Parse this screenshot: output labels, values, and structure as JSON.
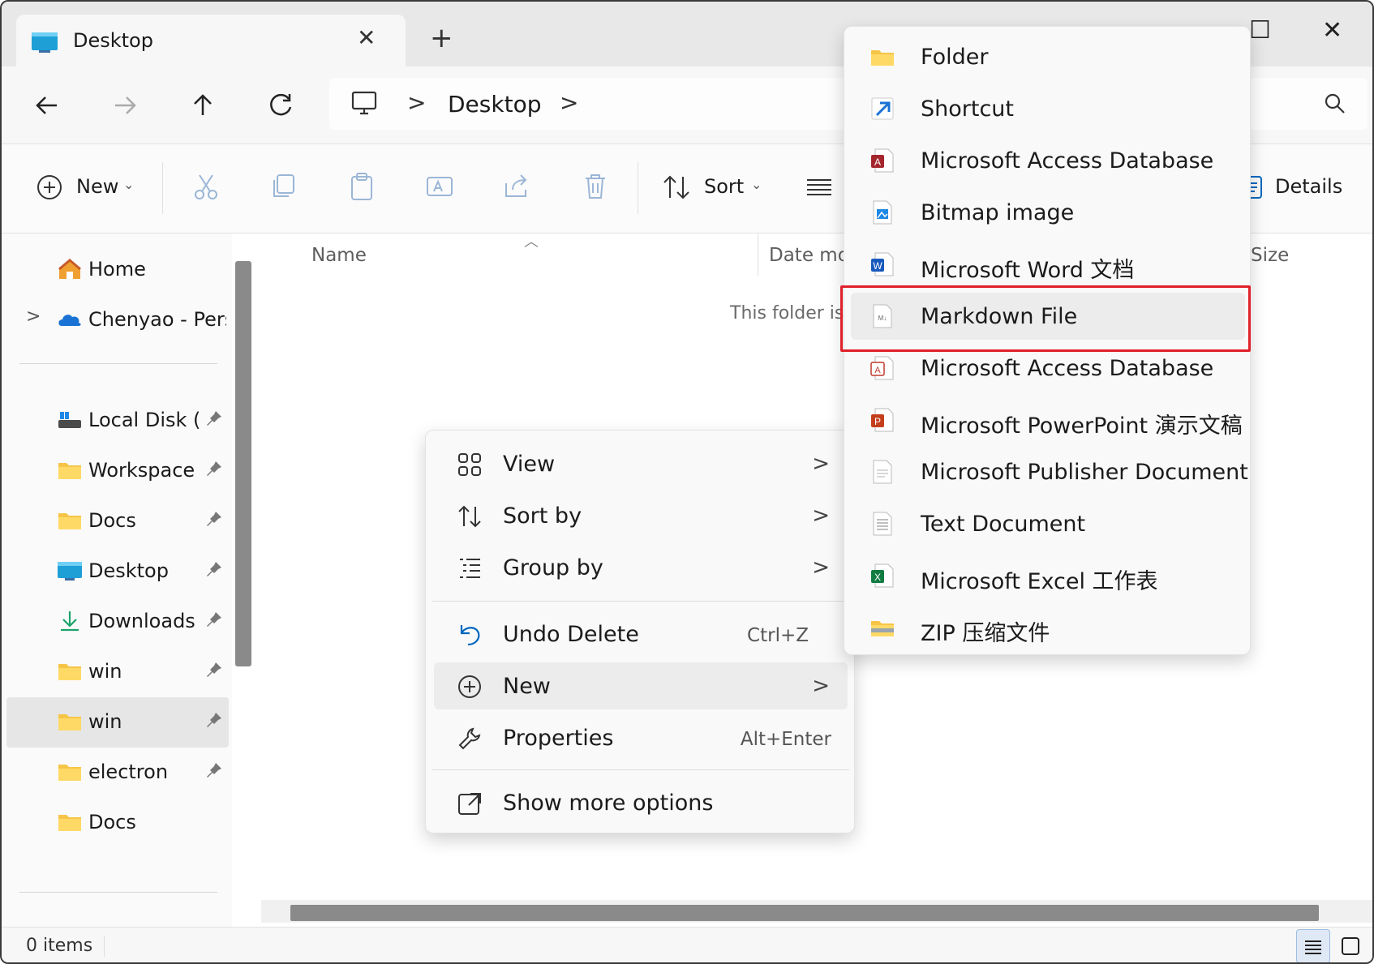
{
  "tab": {
    "title": "Desktop",
    "close_glyph": "✕",
    "new_tab_glyph": "+"
  },
  "window_controls": {
    "minimize": "—",
    "maximize": "☐",
    "close": "✕"
  },
  "nav": {
    "back_icon": "arrow-left-icon",
    "forward_icon": "arrow-right-icon",
    "up_icon": "arrow-up-icon",
    "refresh_icon": "refresh-icon"
  },
  "address": {
    "root_icon": "computer-icon",
    "location": "Desktop",
    "separator": ">"
  },
  "toolbar": {
    "new_label": "New",
    "sort_label": "Sort",
    "details_label": "Details"
  },
  "sidebar": {
    "items": [
      {
        "label": "Home",
        "icon": "home-icon"
      },
      {
        "label": "Chenyao - Perso",
        "icon": "onedrive-icon",
        "expand": ">"
      },
      {
        "label": "Local Disk (C:",
        "icon": "drive-icon"
      },
      {
        "label": "Workspace",
        "icon": "folder-icon"
      },
      {
        "label": "Docs",
        "icon": "folder-icon"
      },
      {
        "label": "Desktop",
        "icon": "desktop-icon"
      },
      {
        "label": "Downloads",
        "icon": "download-icon"
      },
      {
        "label": "win",
        "icon": "folder-icon"
      },
      {
        "label": "win",
        "icon": "folder-icon",
        "selected": true
      },
      {
        "label": "electron",
        "icon": "folder-icon"
      },
      {
        "label": "Docs",
        "icon": "folder-icon"
      }
    ]
  },
  "columns": {
    "name": "Name",
    "date": "Date mo",
    "size": "Size"
  },
  "empty_message": "This folder is",
  "status": {
    "items": "0 items"
  },
  "context_menu": {
    "items": [
      {
        "label": "View",
        "icon": "grid-icon",
        "submenu": ">"
      },
      {
        "label": "Sort by",
        "icon": "sort-icon",
        "submenu": ">"
      },
      {
        "label": "Group by",
        "icon": "group-icon",
        "submenu": ">"
      },
      {
        "label": "Undo Delete",
        "icon": "undo-icon",
        "shortcut": "Ctrl+Z"
      },
      {
        "label": "New",
        "icon": "plus-circle-icon",
        "submenu": ">"
      },
      {
        "label": "Properties",
        "icon": "wrench-icon",
        "shortcut": "Alt+Enter"
      },
      {
        "label": "Show more options",
        "icon": "external-icon"
      }
    ]
  },
  "new_submenu": {
    "items": [
      {
        "label": "Folder",
        "icon": "folder-icon"
      },
      {
        "label": "Shortcut",
        "icon": "shortcut-icon"
      },
      {
        "label": "Microsoft Access Database",
        "icon": "access-icon"
      },
      {
        "label": "Bitmap image",
        "icon": "bitmap-icon"
      },
      {
        "label": "Microsoft Word 文档",
        "icon": "word-icon"
      },
      {
        "label": "Markdown File",
        "icon": "markdown-icon",
        "highlighted": true
      },
      {
        "label": "Microsoft Access Database",
        "icon": "access-icon"
      },
      {
        "label": "Microsoft PowerPoint 演示文稿",
        "icon": "powerpoint-icon"
      },
      {
        "label": "Microsoft Publisher Document",
        "icon": "publisher-icon"
      },
      {
        "label": "Text Document",
        "icon": "text-icon"
      },
      {
        "label": "Microsoft Excel 工作表",
        "icon": "excel-icon"
      },
      {
        "label": "ZIP 压缩文件",
        "icon": "zip-icon"
      }
    ]
  },
  "colors": {
    "accent": "#0067c0",
    "highlight_border": "#e0202a",
    "folder": "#f6c548"
  }
}
